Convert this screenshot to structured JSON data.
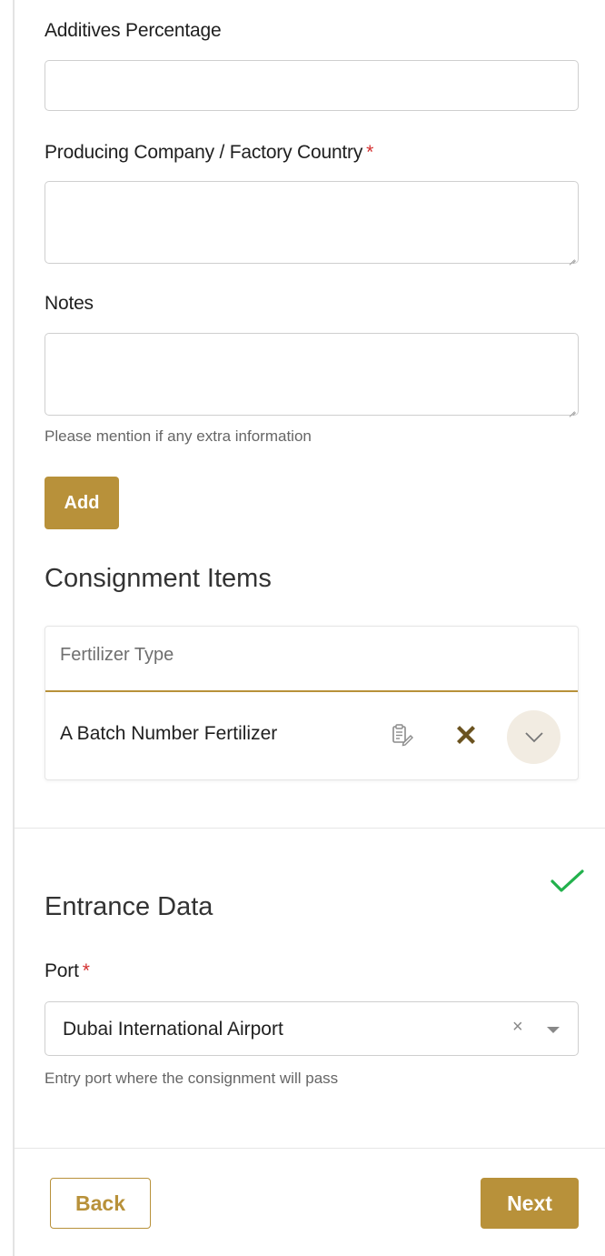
{
  "form": {
    "additives_label": "Additives Percentage",
    "additives_value": "",
    "producing_label": "Producing Company / Factory Country",
    "required_mark": "*",
    "producing_value": "",
    "notes_label": "Notes",
    "notes_value": "",
    "notes_hint": "Please mention if any extra information",
    "add_label": "Add"
  },
  "consignment": {
    "title": "Consignment Items",
    "column_header": "Fertilizer Type",
    "items": [
      {
        "name": "A Batch Number Fertilizer"
      }
    ],
    "icons": {
      "edit": "edit-clipboard-icon",
      "delete": "close-icon",
      "expand": "chevron-down-icon"
    },
    "accent_color": "#b8913a"
  },
  "entrance": {
    "title": "Entrance Data",
    "status_icon": "checkmark-icon",
    "status_color": "#22b14c",
    "port_label": "Port",
    "required_mark": "*",
    "port_value": "Dubai International Airport",
    "clear_glyph": "×",
    "port_hint": "Entry port where the consignment will pass"
  },
  "footer": {
    "back_label": "Back",
    "next_label": "Next"
  }
}
